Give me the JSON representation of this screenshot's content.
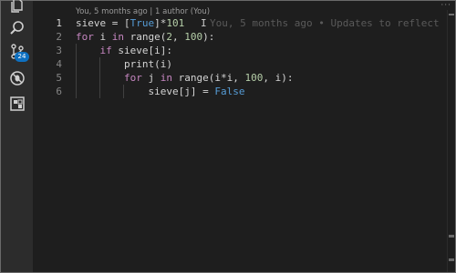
{
  "activity_bar": {
    "items": [
      {
        "name": "explorer-icon"
      },
      {
        "name": "search-icon"
      },
      {
        "name": "source-control-icon",
        "badge": "24"
      },
      {
        "name": "debug-icon"
      },
      {
        "name": "extensions-icon"
      }
    ]
  },
  "editor": {
    "codelens": "You, 5 months ago | 1 author (You)",
    "line_numbers": [
      "1",
      "2",
      "3",
      "4",
      "5",
      "6"
    ],
    "active_line": "1",
    "blame": "You, 5 months ago • Updates to reflect",
    "top_right_indicator": "···",
    "lines": [
      [
        {
          "t": "sieve = [",
          "c": "plain"
        },
        {
          "t": "True",
          "c": "co"
        },
        {
          "t": "]*",
          "c": "plain"
        },
        {
          "t": "101",
          "c": "nu"
        }
      ],
      [
        {
          "t": "for",
          "c": "kw"
        },
        {
          "t": " i ",
          "c": "plain"
        },
        {
          "t": "in",
          "c": "kw"
        },
        {
          "t": " ",
          "c": "plain"
        },
        {
          "t": "range",
          "c": "plain"
        },
        {
          "t": "(",
          "c": "plain"
        },
        {
          "t": "2",
          "c": "nu"
        },
        {
          "t": ", ",
          "c": "plain"
        },
        {
          "t": "100",
          "c": "nu"
        },
        {
          "t": "):",
          "c": "plain"
        }
      ],
      [
        {
          "t": "    ",
          "c": "plain"
        },
        {
          "t": "if",
          "c": "kw"
        },
        {
          "t": " sieve[i]:",
          "c": "plain"
        }
      ],
      [
        {
          "t": "        print(i)",
          "c": "plain"
        }
      ],
      [
        {
          "t": "        ",
          "c": "plain"
        },
        {
          "t": "for",
          "c": "kw"
        },
        {
          "t": " j ",
          "c": "plain"
        },
        {
          "t": "in",
          "c": "kw"
        },
        {
          "t": " range(i*i, ",
          "c": "plain"
        },
        {
          "t": "100",
          "c": "nu"
        },
        {
          "t": ", i):",
          "c": "plain"
        }
      ],
      [
        {
          "t": "            sieve[j] = ",
          "c": "plain"
        },
        {
          "t": "False",
          "c": "co"
        }
      ]
    ]
  }
}
